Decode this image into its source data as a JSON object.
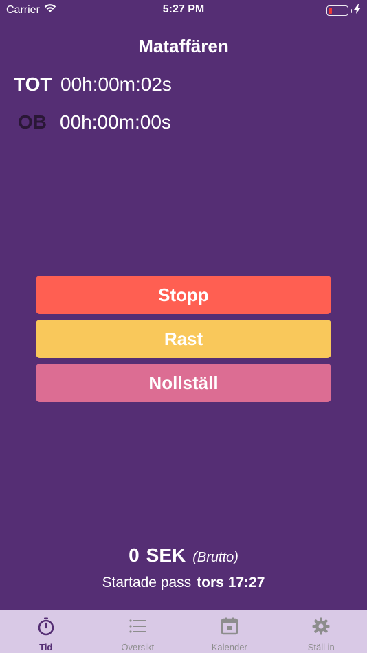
{
  "status_bar": {
    "carrier": "Carrier",
    "time": "5:27 PM"
  },
  "title": "Mataffären",
  "timers": {
    "tot": {
      "label": "TOT",
      "value": "00h:00m:02s"
    },
    "ob": {
      "label": "OB",
      "value": "00h:00m:00s"
    }
  },
  "buttons": {
    "stop": {
      "label": "Stopp",
      "color": "#ff5f52"
    },
    "rast": {
      "label": "Rast",
      "color": "#f9c85b"
    },
    "reset": {
      "label": "Nollställ",
      "color": "#dc6d93"
    }
  },
  "earnings": {
    "amount": "0",
    "currency": "SEK",
    "note": "(Brutto)"
  },
  "shift": {
    "label": "Startade pass",
    "time": "tors 17:27"
  },
  "tabbar": {
    "tabs": [
      {
        "label": "Tid",
        "icon": "stopwatch-icon",
        "active": true
      },
      {
        "label": "Översikt",
        "icon": "list-icon",
        "active": false
      },
      {
        "label": "Kalender",
        "icon": "calendar-icon",
        "active": false
      },
      {
        "label": "Ställ in",
        "icon": "gear-icon",
        "active": false
      }
    ]
  },
  "colors": {
    "background": "#552e74",
    "tabbar": "#d9c9e6",
    "active_tab": "#552e74",
    "inactive_tab": "#8d8d8d",
    "battery_low": "#ff3b30"
  }
}
